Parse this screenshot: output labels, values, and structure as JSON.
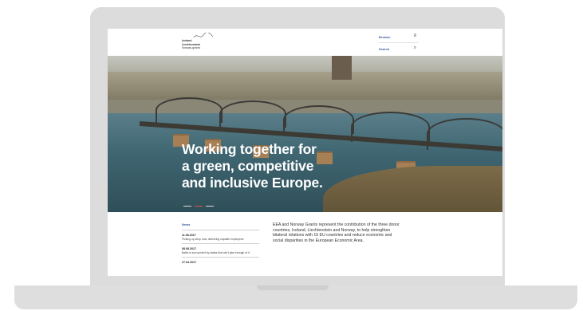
{
  "site": {
    "logo_lines": [
      "Iceland",
      "Liechtenstein",
      "Norway grants"
    ],
    "logo_side": "Norway grants",
    "nav": [
      {
        "label": "Browse",
        "icon": "menu-icon"
      },
      {
        "label": "Search",
        "icon": "search-icon"
      }
    ]
  },
  "hero": {
    "title_lines": [
      "Working together for",
      "a green, competitive",
      "and inclusive Europe."
    ]
  },
  "news": {
    "heading": "News",
    "items": [
      {
        "date": "11.08.2017",
        "text": "Picking up shop now, delivering capable employees"
      },
      {
        "date": "08.08.2017",
        "text": "Baltic is surrounded by states that can't give enough of it"
      },
      {
        "date": "27.04.2017",
        "text": ""
      }
    ]
  },
  "intro": {
    "text": "EEA and Norway Grants represent the contribution of the three donor countries, Iceland, Liechtenstein and Norway, to help strengthen bilateral relations with 15 EU countries and reduce economic and social disparities in the European Economic Area."
  },
  "colors": {
    "accent": "#3b5b9b",
    "active_dot": "#e0554b",
    "device": "#dcdcdc"
  }
}
